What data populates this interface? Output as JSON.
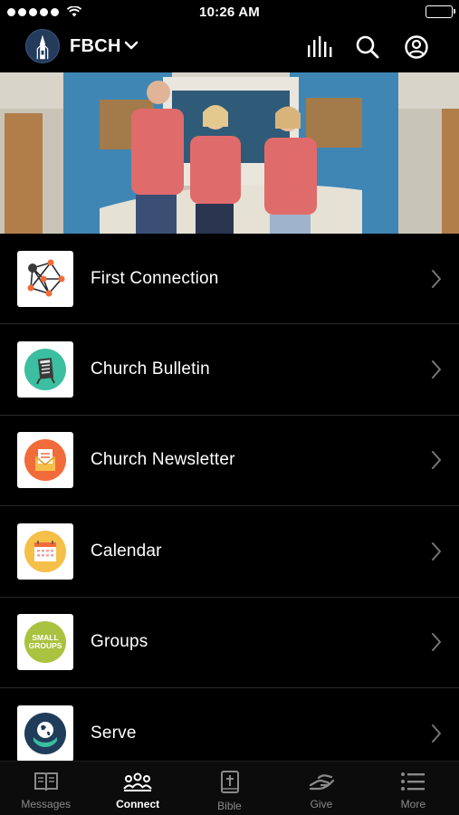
{
  "status_bar": {
    "time": "10:26 AM"
  },
  "header": {
    "church_name": "FBCH"
  },
  "list": {
    "items": [
      {
        "label": "First Connection"
      },
      {
        "label": "Church Bulletin"
      },
      {
        "label": "Church Newsletter"
      },
      {
        "label": "Calendar"
      },
      {
        "label": "Groups",
        "icon_text_1": "SMALL",
        "icon_text_2": "GROUPS"
      },
      {
        "label": "Serve"
      }
    ]
  },
  "tabbar": {
    "tabs": [
      {
        "label": "Messages"
      },
      {
        "label": "Connect"
      },
      {
        "label": "Bible"
      },
      {
        "label": "Give"
      },
      {
        "label": "More"
      }
    ],
    "active": "Connect"
  },
  "colors": {
    "background": "#000000",
    "accent_teal": "#3bbfa0",
    "accent_orange": "#f26b3a",
    "accent_yellow": "#f5c04a",
    "accent_green": "#a9c23f",
    "accent_navy": "#1f3d5a"
  }
}
